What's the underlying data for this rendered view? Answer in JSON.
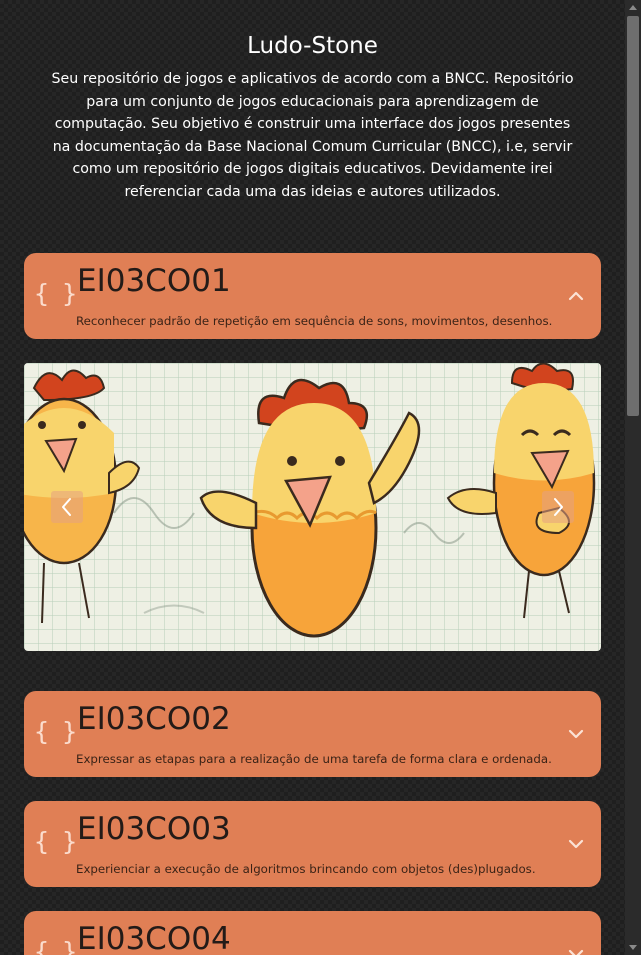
{
  "header": {
    "title": "Ludo-Stone",
    "description": "Seu repositório de jogos e aplicativos de acordo com a BNCC. Repositório para um conjunto de jogos educacionais para aprendizagem de computação. Seu objetivo é construir uma interface dos jogos presentes na documentação da Base Nacional Comum Curricular (BNCC), i.e, servir como um repositório de jogos digitais educativos. Devidamente irei referenciar cada uma das ideias e autores utilizados."
  },
  "cards": [
    {
      "code": "EI03CO01",
      "text": "Reconhecer padrão de repetição em sequência de sons, movimentos, desenhos.",
      "expanded": true,
      "icon": "code-braces-icon"
    },
    {
      "code": "EI03CO02",
      "text": "Expressar as etapas para a realização de uma tarefa de forma clara e ordenada.",
      "expanded": false,
      "icon": "code-braces-icon"
    },
    {
      "code": "EI03CO03",
      "text": "Experienciar a execução de algoritmos brincando com objetos (des)plugados.",
      "expanded": false,
      "icon": "code-braces-icon"
    },
    {
      "code": "EI03CO04",
      "text": "",
      "expanded": false,
      "icon": "code-braces-icon"
    }
  ],
  "carousel": {
    "prev_icon": "chevron-left-icon",
    "next_icon": "chevron-right-icon",
    "image": "dancing-chickens-illustration"
  },
  "colors": {
    "card": "#e07f55",
    "background": "#262626",
    "text": "#ffffff"
  }
}
